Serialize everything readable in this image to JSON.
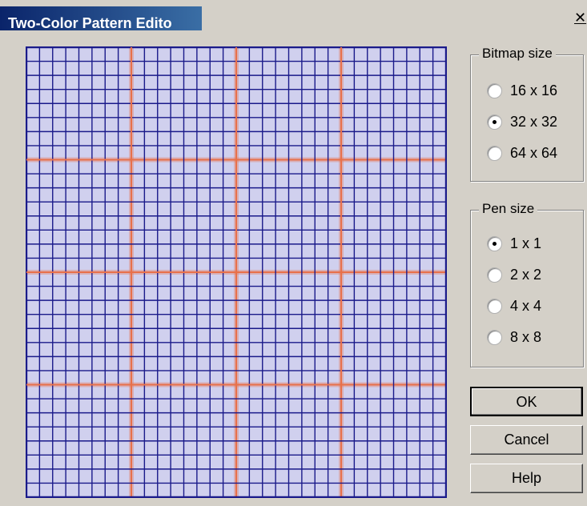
{
  "window": {
    "title": "Two-Color Pattern Edito"
  },
  "close_icon": "close-icon",
  "bitmap_size": {
    "legend": "Bitmap size",
    "options": [
      {
        "label": "16 x 16",
        "checked": false
      },
      {
        "label": "32 x 32",
        "checked": true
      },
      {
        "label": "64 x 64",
        "checked": false
      }
    ]
  },
  "pen_size": {
    "legend": "Pen size",
    "options": [
      {
        "label": "1 x 1",
        "checked": true
      },
      {
        "label": "2 x 2",
        "checked": false
      },
      {
        "label": "4 x 4",
        "checked": false
      },
      {
        "label": "8 x 8",
        "checked": false
      }
    ]
  },
  "buttons": {
    "ok": "OK",
    "cancel": "Cancel",
    "help": "Help"
  },
  "grid": {
    "cells": 32,
    "guide_every": 8,
    "cell_color": "#d0d0ee",
    "line_color": "#1a1a8a",
    "guide_color": "#e8704a"
  }
}
